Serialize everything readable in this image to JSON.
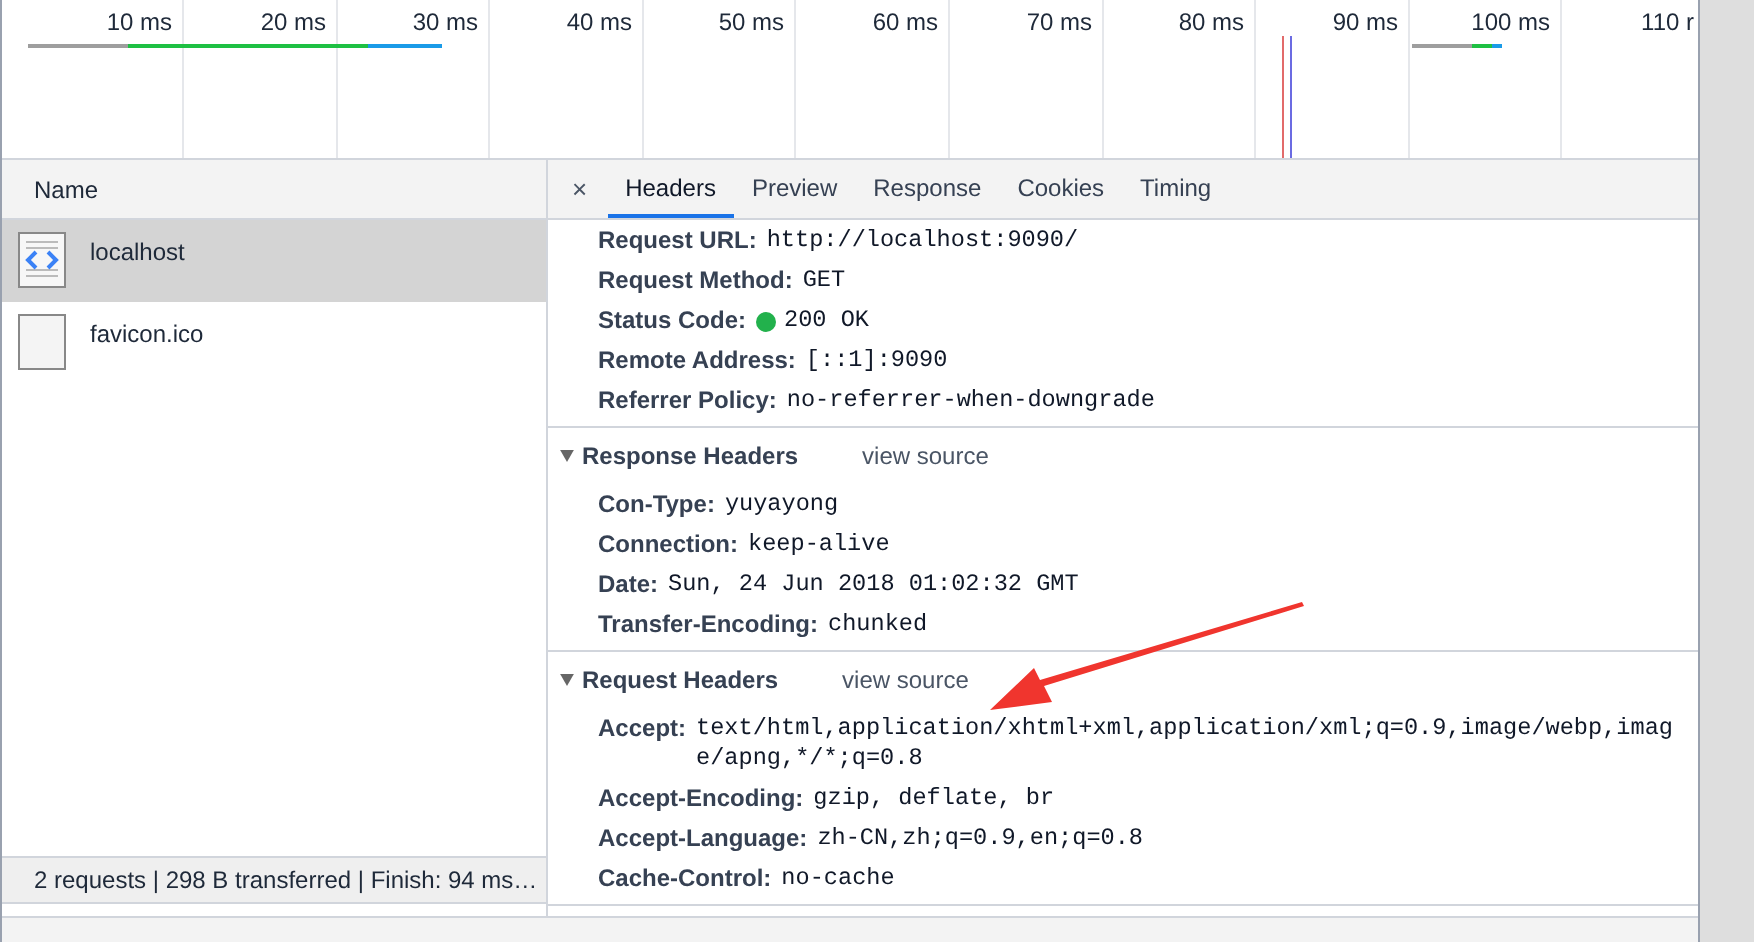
{
  "timeline": {
    "ticks": [
      "10 ms",
      "20 ms",
      "30 ms",
      "40 ms",
      "50 ms",
      "60 ms",
      "70 ms",
      "80 ms",
      "90 ms",
      "100 ms",
      "110 r"
    ]
  },
  "requests": {
    "column": "Name",
    "rows": [
      {
        "name": "localhost",
        "kind": "document",
        "selected": true
      },
      {
        "name": "favicon.ico",
        "kind": "file",
        "selected": false
      }
    ]
  },
  "details": {
    "close": "×",
    "tabs": [
      {
        "label": "Headers",
        "selected": true
      },
      {
        "label": "Preview",
        "selected": false
      },
      {
        "label": "Response",
        "selected": false
      },
      {
        "label": "Cookies",
        "selected": false
      },
      {
        "label": "Timing",
        "selected": false
      }
    ],
    "general": [
      {
        "key": "Request URL:",
        "value": "http://localhost:9090/"
      },
      {
        "key": "Request Method:",
        "value": "GET"
      },
      {
        "key": "Status Code:",
        "value": "200 OK",
        "color": "#22b14c"
      },
      {
        "key": "Remote Address:",
        "value": "[::1]:9090"
      },
      {
        "key": "Referrer Policy:",
        "value": "no-referrer-when-downgrade"
      }
    ],
    "sections": [
      {
        "title": "Response Headers",
        "expanded": true,
        "link": "view source",
        "rows": [
          {
            "key": "Con-Type:",
            "value": "yuyayong"
          },
          {
            "key": "Connection:",
            "value": "keep-alive"
          },
          {
            "key": "Date:",
            "value": "Sun, 24 Jun 2018 01:02:32 GMT"
          },
          {
            "key": "Transfer-Encoding:",
            "value": "chunked"
          }
        ]
      },
      {
        "title": "Request Headers",
        "expanded": true,
        "link": "view source",
        "rows": [
          {
            "key": "Accept:",
            "value": "text/html,application/xhtml+xml,application/xml;q=0.9,image/webp,image/apng,*/*;q=0.8"
          },
          {
            "key": "Accept-Encoding:",
            "value": "gzip, deflate, br"
          },
          {
            "key": "Accept-Language:",
            "value": "zh-CN,zh;q=0.9,en;q=0.8"
          },
          {
            "key": "Cache-Control:",
            "value": "no-cache"
          }
        ]
      }
    ]
  },
  "status_bar": "2 requests | 298 B transferred | Finish: 94 ms…"
}
